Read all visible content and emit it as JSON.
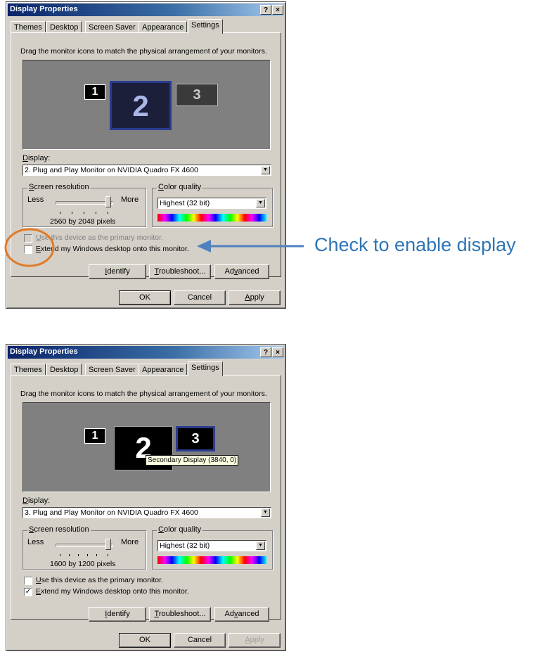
{
  "annotation": {
    "text": "Check to enable display",
    "color": "#2e75b6",
    "arrow_color": "#4f81bd",
    "circle_color": "#e07b28"
  },
  "dialog_top": {
    "title": "Display Properties",
    "help_glyph": "?",
    "close_glyph": "×",
    "tabs": [
      "Themes",
      "Desktop",
      "Screen Saver",
      "Appearance",
      "Settings"
    ],
    "instruction": "Drag the monitor icons to match the physical arrangement of your monitors.",
    "monitors": [
      "1",
      "2",
      "3"
    ],
    "display_label_first": "D",
    "display_label_rest": "isplay:",
    "display_value": "2. Plug and Play Monitor on NVIDIA Quadro FX 4600",
    "resolution_title_first": "S",
    "resolution_title_rest": "creen resolution",
    "less": "Less",
    "more": "More",
    "resolution_value": "2560 by 2048 pixels",
    "color_title_first": "C",
    "color_title_rest": "olor quality",
    "color_value": "Highest (32 bit)",
    "primary_checkbox": {
      "label_first": "U",
      "label_rest": "se this device as the primary monitor.",
      "checked": false,
      "disabled": true
    },
    "extend_checkbox": {
      "label_first": "E",
      "label_rest": "xtend my Windows desktop onto this monitor.",
      "checked": false,
      "disabled": false
    },
    "identify_first": "I",
    "identify_rest": "dentify",
    "troubleshoot_first": "T",
    "troubleshoot_rest": "roubleshoot...",
    "advanced_pre": "Ad",
    "advanced_u": "v",
    "advanced_post": "anced",
    "ok": "OK",
    "cancel": "Cancel",
    "apply_first": "A",
    "apply_rest": "pply"
  },
  "dialog_bottom": {
    "title": "Display Properties",
    "help_glyph": "?",
    "close_glyph": "×",
    "tabs": [
      "Themes",
      "Desktop",
      "Screen Saver",
      "Appearance",
      "Settings"
    ],
    "instruction": "Drag the monitor icons to match the physical arrangement of your monitors.",
    "monitors": [
      "1",
      "2",
      "3"
    ],
    "tooltip": "Secondary Display (3840, 0)",
    "display_label_first": "D",
    "display_label_rest": "isplay:",
    "display_value": "3. Plug and Play Monitor on NVIDIA Quadro FX 4600",
    "resolution_title_first": "S",
    "resolution_title_rest": "creen resolution",
    "less": "Less",
    "more": "More",
    "resolution_value": "1600 by 1200 pixels",
    "color_title_first": "C",
    "color_title_rest": "olor quality",
    "color_value": "Highest (32 bit)",
    "primary_checkbox": {
      "label_first": "U",
      "label_rest": "se this device as the primary monitor.",
      "checked": false,
      "disabled": false
    },
    "extend_checkbox": {
      "label_first": "E",
      "label_rest": "xtend my Windows desktop onto this monitor.",
      "checked": true,
      "disabled": false
    },
    "check_glyph": "✓",
    "identify_first": "I",
    "identify_rest": "dentify",
    "troubleshoot_first": "T",
    "troubleshoot_rest": "roubleshoot...",
    "advanced_pre": "Ad",
    "advanced_u": "v",
    "advanced_post": "anced",
    "ok": "OK",
    "cancel": "Cancel",
    "apply_first": "A",
    "apply_rest": "pply",
    "apply_disabled": true
  }
}
